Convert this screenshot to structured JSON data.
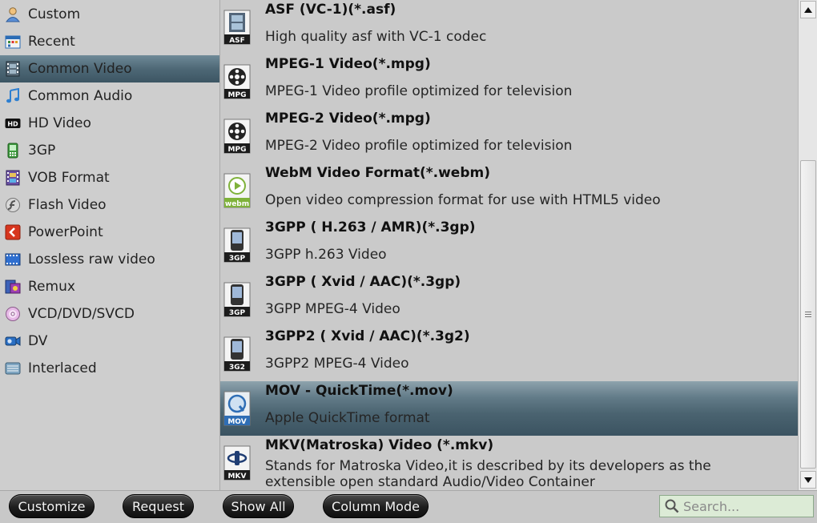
{
  "categories": [
    {
      "label": "Custom",
      "icon": "user-icon"
    },
    {
      "label": "Recent",
      "icon": "calendar-icon"
    },
    {
      "label": "Common Video",
      "icon": "film-icon",
      "selected": true
    },
    {
      "label": "Common Audio",
      "icon": "music-note-icon"
    },
    {
      "label": "HD Video",
      "icon": "hd-icon"
    },
    {
      "label": "3GP",
      "icon": "phone-icon"
    },
    {
      "label": "VOB Format",
      "icon": "film-strip-icon"
    },
    {
      "label": "Flash Video",
      "icon": "flash-icon"
    },
    {
      "label": "PowerPoint",
      "icon": "powerpoint-icon"
    },
    {
      "label": "Lossless raw video",
      "icon": "raw-film-icon"
    },
    {
      "label": "Remux",
      "icon": "remux-icon"
    },
    {
      "label": "VCD/DVD/SVCD",
      "icon": "disc-icon"
    },
    {
      "label": "DV",
      "icon": "camcorder-icon"
    },
    {
      "label": "Interlaced",
      "icon": "interlaced-icon"
    }
  ],
  "formats": [
    {
      "title": "ASF (VC-1)(*.asf)",
      "description": "High quality asf with VC-1 codec",
      "badge": "ASF",
      "icon": "asf-format-icon"
    },
    {
      "title": "MPEG-1 Video(*.mpg)",
      "description": "MPEG-1 Video profile optimized for television",
      "badge": "MPG",
      "icon": "mpg-format-icon"
    },
    {
      "title": "MPEG-2 Video(*.mpg)",
      "description": "MPEG-2 Video profile optimized for television",
      "badge": "MPG",
      "icon": "mpg-format-icon"
    },
    {
      "title": "WebM Video Format(*.webm)",
      "description": "Open video compression format for use with HTML5 video",
      "badge": "webm",
      "icon": "webm-format-icon"
    },
    {
      "title": "3GPP ( H.263 / AMR)(*.3gp)",
      "description": "3GPP h.263 Video",
      "badge": "3GP",
      "icon": "3gp-format-icon"
    },
    {
      "title": "3GPP ( Xvid / AAC)(*.3gp)",
      "description": "3GPP MPEG-4 Video",
      "badge": "3GP",
      "icon": "3gp-format-icon"
    },
    {
      "title": "3GPP2 ( Xvid / AAC)(*.3g2)",
      "description": "3GPP2 MPEG-4 Video",
      "badge": "3G2",
      "icon": "3g2-format-icon"
    },
    {
      "title": "MOV - QuickTime(*.mov)",
      "description": "Apple QuickTime format",
      "badge": "MOV",
      "icon": "mov-format-icon",
      "selected": true
    },
    {
      "title": "MKV(Matroska) Video (*.mkv)",
      "description": "Stands for Matroska Video,it is described by its developers as the extensible open standard Audio/Video Container",
      "badge": "MKV",
      "icon": "mkv-format-icon"
    }
  ],
  "buttons": {
    "customize": "Customize",
    "request": "Request",
    "show_all": "Show All",
    "column_mode": "Column Mode"
  },
  "search": {
    "placeholder": "Search...",
    "value": ""
  },
  "colors": {
    "selection": "#4e6876",
    "search_bg": "#dcebd6",
    "button_bg": "#1d1d1d"
  }
}
